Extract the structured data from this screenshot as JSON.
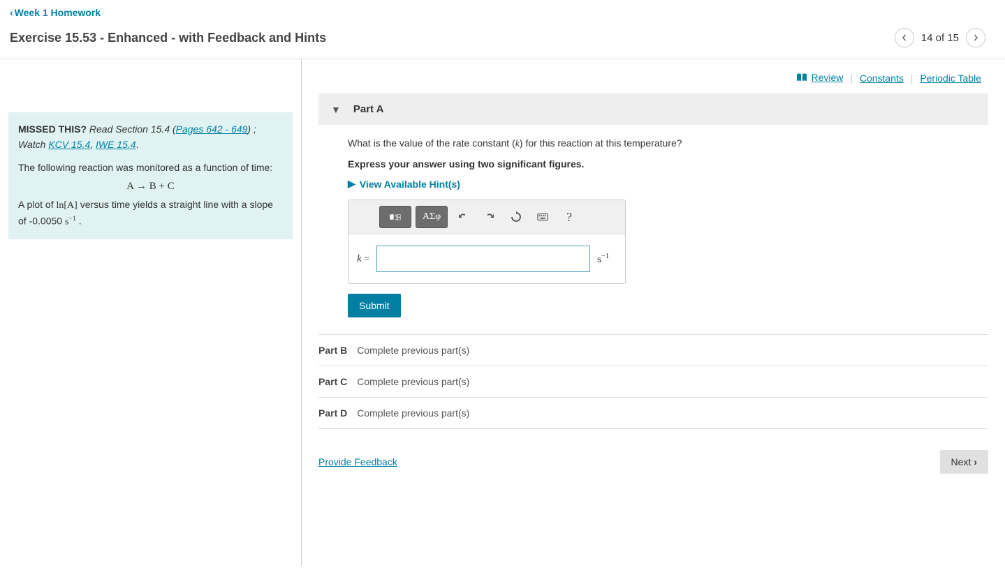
{
  "breadcrumb": {
    "label": "Week 1 Homework"
  },
  "exercise": {
    "title": "Exercise 15.53 - Enhanced - with Feedback and Hints"
  },
  "pager": {
    "label": "14 of 15"
  },
  "toplinks": {
    "review": "Review",
    "constants": "Constants",
    "periodic": "Periodic Table"
  },
  "info": {
    "missed_label": "MISSED THIS?",
    "read_prefix": "Read Section 15.4 (",
    "pages_link": "Pages 642 - 649",
    "read_suffix": ") ; Watch ",
    "kcv_link": "KCV 15.4",
    "comma": ", ",
    "iwe_link": "IWE 15.4",
    "period": ".",
    "intro": "The following reaction was monitored as a function of time:",
    "equation": "A → B + C",
    "plot_prefix": "A plot of ",
    "lnA": "ln[A]",
    "plot_mid": " versus time yields a straight line with a slope of -0.0050 ",
    "unit_s": "s",
    "unit_exp": "−1",
    "plot_end": " ."
  },
  "partA": {
    "label": "Part A",
    "question_pre": "What is the value of the rate constant (",
    "k": "k",
    "question_post": ") for this reaction at this temperature?",
    "instruction": "Express your answer using two significant figures.",
    "hints": "View Available Hint(s)",
    "tool_sigma": "ΑΣφ",
    "k_eq": "k",
    "eq_sign": " = ",
    "unit_s": "s",
    "unit_exp": "−1",
    "submit": "Submit"
  },
  "parts_locked": [
    {
      "label": "Part B",
      "text": "Complete previous part(s)"
    },
    {
      "label": "Part C",
      "text": "Complete previous part(s)"
    },
    {
      "label": "Part D",
      "text": "Complete previous part(s)"
    }
  ],
  "footer": {
    "feedback": "Provide Feedback",
    "next": "Next"
  }
}
